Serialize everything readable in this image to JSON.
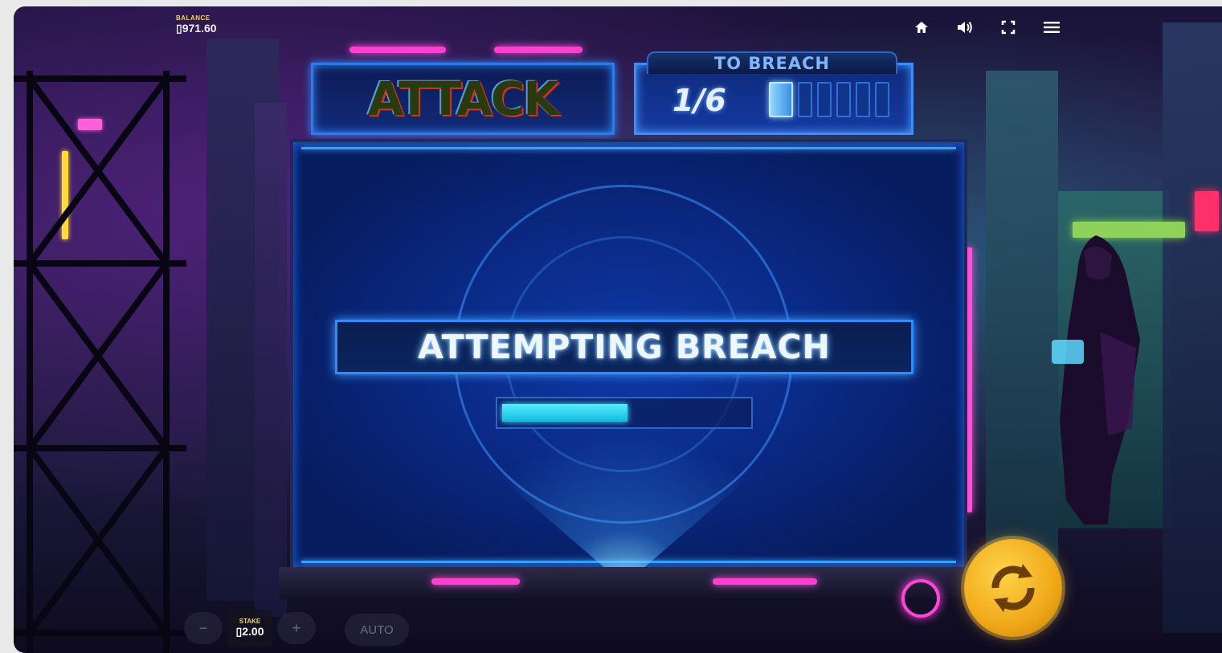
{
  "hud": {
    "balance_label": "BALANCE",
    "balance_value": "971.60",
    "currency_symbol": "▯"
  },
  "icons": [
    "home-icon",
    "sound-icon",
    "fullscreen-icon",
    "menu-icon"
  ],
  "header": {
    "attack_label": "ATTACK",
    "to_breach_label": "TO BREACH",
    "breach_count": "1/6",
    "breach_total": 6,
    "breach_filled": 1
  },
  "screen": {
    "status_text": "ATTEMPTING BREACH",
    "progress": 0.52
  },
  "controls": {
    "stake_label": "STAKE",
    "stake_value": "2.00",
    "minus_label": "−",
    "plus_label": "+",
    "auto_label": "AUTO"
  },
  "colors": {
    "accent_blue": "#2f8cff",
    "neon_pink": "#ff3fd0",
    "spin_gold": "#f0a818",
    "progress_cyan": "#4ff0ff"
  }
}
